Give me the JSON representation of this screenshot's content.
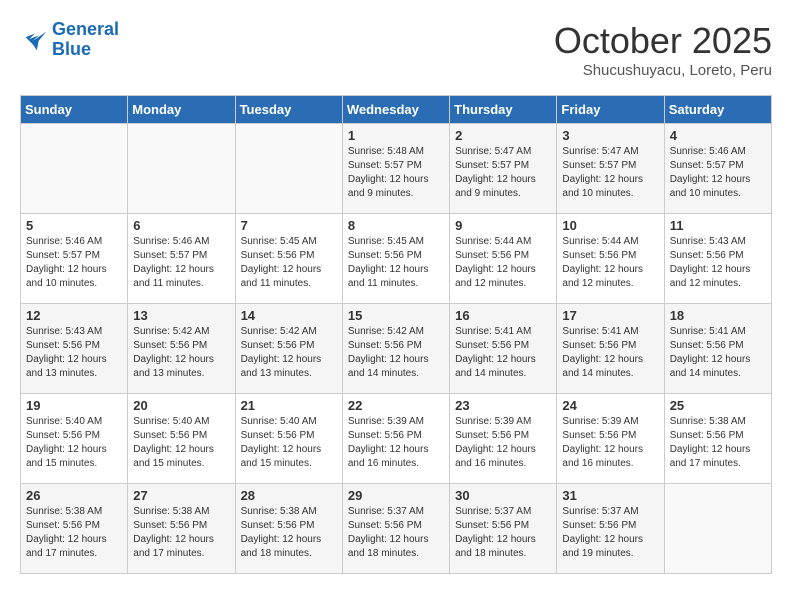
{
  "header": {
    "logo_line1": "General",
    "logo_line2": "Blue",
    "month": "October 2025",
    "location": "Shucushuyacu, Loreto, Peru"
  },
  "days_of_week": [
    "Sunday",
    "Monday",
    "Tuesday",
    "Wednesday",
    "Thursday",
    "Friday",
    "Saturday"
  ],
  "weeks": [
    [
      {
        "day": "",
        "info": ""
      },
      {
        "day": "",
        "info": ""
      },
      {
        "day": "",
        "info": ""
      },
      {
        "day": "1",
        "info": "Sunrise: 5:48 AM\nSunset: 5:57 PM\nDaylight: 12 hours\nand 9 minutes."
      },
      {
        "day": "2",
        "info": "Sunrise: 5:47 AM\nSunset: 5:57 PM\nDaylight: 12 hours\nand 9 minutes."
      },
      {
        "day": "3",
        "info": "Sunrise: 5:47 AM\nSunset: 5:57 PM\nDaylight: 12 hours\nand 10 minutes."
      },
      {
        "day": "4",
        "info": "Sunrise: 5:46 AM\nSunset: 5:57 PM\nDaylight: 12 hours\nand 10 minutes."
      }
    ],
    [
      {
        "day": "5",
        "info": "Sunrise: 5:46 AM\nSunset: 5:57 PM\nDaylight: 12 hours\nand 10 minutes."
      },
      {
        "day": "6",
        "info": "Sunrise: 5:46 AM\nSunset: 5:57 PM\nDaylight: 12 hours\nand 11 minutes."
      },
      {
        "day": "7",
        "info": "Sunrise: 5:45 AM\nSunset: 5:56 PM\nDaylight: 12 hours\nand 11 minutes."
      },
      {
        "day": "8",
        "info": "Sunrise: 5:45 AM\nSunset: 5:56 PM\nDaylight: 12 hours\nand 11 minutes."
      },
      {
        "day": "9",
        "info": "Sunrise: 5:44 AM\nSunset: 5:56 PM\nDaylight: 12 hours\nand 12 minutes."
      },
      {
        "day": "10",
        "info": "Sunrise: 5:44 AM\nSunset: 5:56 PM\nDaylight: 12 hours\nand 12 minutes."
      },
      {
        "day": "11",
        "info": "Sunrise: 5:43 AM\nSunset: 5:56 PM\nDaylight: 12 hours\nand 12 minutes."
      }
    ],
    [
      {
        "day": "12",
        "info": "Sunrise: 5:43 AM\nSunset: 5:56 PM\nDaylight: 12 hours\nand 13 minutes."
      },
      {
        "day": "13",
        "info": "Sunrise: 5:42 AM\nSunset: 5:56 PM\nDaylight: 12 hours\nand 13 minutes."
      },
      {
        "day": "14",
        "info": "Sunrise: 5:42 AM\nSunset: 5:56 PM\nDaylight: 12 hours\nand 13 minutes."
      },
      {
        "day": "15",
        "info": "Sunrise: 5:42 AM\nSunset: 5:56 PM\nDaylight: 12 hours\nand 14 minutes."
      },
      {
        "day": "16",
        "info": "Sunrise: 5:41 AM\nSunset: 5:56 PM\nDaylight: 12 hours\nand 14 minutes."
      },
      {
        "day": "17",
        "info": "Sunrise: 5:41 AM\nSunset: 5:56 PM\nDaylight: 12 hours\nand 14 minutes."
      },
      {
        "day": "18",
        "info": "Sunrise: 5:41 AM\nSunset: 5:56 PM\nDaylight: 12 hours\nand 14 minutes."
      }
    ],
    [
      {
        "day": "19",
        "info": "Sunrise: 5:40 AM\nSunset: 5:56 PM\nDaylight: 12 hours\nand 15 minutes."
      },
      {
        "day": "20",
        "info": "Sunrise: 5:40 AM\nSunset: 5:56 PM\nDaylight: 12 hours\nand 15 minutes."
      },
      {
        "day": "21",
        "info": "Sunrise: 5:40 AM\nSunset: 5:56 PM\nDaylight: 12 hours\nand 15 minutes."
      },
      {
        "day": "22",
        "info": "Sunrise: 5:39 AM\nSunset: 5:56 PM\nDaylight: 12 hours\nand 16 minutes."
      },
      {
        "day": "23",
        "info": "Sunrise: 5:39 AM\nSunset: 5:56 PM\nDaylight: 12 hours\nand 16 minutes."
      },
      {
        "day": "24",
        "info": "Sunrise: 5:39 AM\nSunset: 5:56 PM\nDaylight: 12 hours\nand 16 minutes."
      },
      {
        "day": "25",
        "info": "Sunrise: 5:38 AM\nSunset: 5:56 PM\nDaylight: 12 hours\nand 17 minutes."
      }
    ],
    [
      {
        "day": "26",
        "info": "Sunrise: 5:38 AM\nSunset: 5:56 PM\nDaylight: 12 hours\nand 17 minutes."
      },
      {
        "day": "27",
        "info": "Sunrise: 5:38 AM\nSunset: 5:56 PM\nDaylight: 12 hours\nand 17 minutes."
      },
      {
        "day": "28",
        "info": "Sunrise: 5:38 AM\nSunset: 5:56 PM\nDaylight: 12 hours\nand 18 minutes."
      },
      {
        "day": "29",
        "info": "Sunrise: 5:37 AM\nSunset: 5:56 PM\nDaylight: 12 hours\nand 18 minutes."
      },
      {
        "day": "30",
        "info": "Sunrise: 5:37 AM\nSunset: 5:56 PM\nDaylight: 12 hours\nand 18 minutes."
      },
      {
        "day": "31",
        "info": "Sunrise: 5:37 AM\nSunset: 5:56 PM\nDaylight: 12 hours\nand 19 minutes."
      },
      {
        "day": "",
        "info": ""
      }
    ]
  ]
}
